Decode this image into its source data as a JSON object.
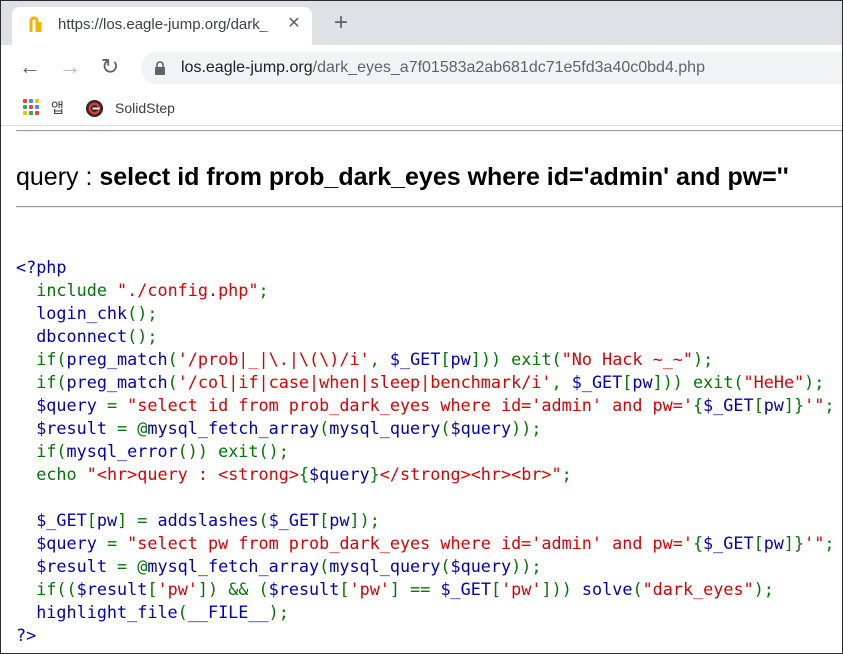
{
  "browser": {
    "tab": {
      "title": "https://los.eagle-jump.org/dark_",
      "close_glyph": "✕",
      "favicon": "tab-favicon-icon"
    },
    "new_tab_glyph": "+",
    "nav": {
      "back": "←",
      "forward": "→",
      "reload": "↻"
    },
    "address": {
      "host": "los.eagle-jump.org",
      "path": "/dark_eyes_a7f01583a2ab681dc71e5fd3a40c0bd4.php",
      "icon": "lock-icon"
    },
    "bookmarks": [
      {
        "label": "앱",
        "icon": "apps-grid-icon"
      },
      {
        "label": "SolidStep",
        "icon": "solidstep-icon"
      }
    ]
  },
  "page": {
    "query_label": "query : ",
    "query_value": "select id from prob_dark_eyes where id='admin' and pw=''",
    "colors": {
      "default": "#0000bb",
      "keyword": "#007700",
      "string": "#dd0000"
    },
    "code_lines": [
      [
        [
          "d",
          "<?php"
        ]
      ],
      [
        [
          "d",
          "  "
        ],
        [
          "k",
          "include "
        ],
        [
          "s",
          "\"./config.php\""
        ],
        [
          "k",
          ";"
        ]
      ],
      [
        [
          "d",
          "  login_chk"
        ],
        [
          "k",
          "();"
        ]
      ],
      [
        [
          "d",
          "  dbconnect"
        ],
        [
          "k",
          "();"
        ]
      ],
      [
        [
          "d",
          "  "
        ],
        [
          "k",
          "if("
        ],
        [
          "d",
          "preg_match"
        ],
        [
          "k",
          "("
        ],
        [
          "s",
          "'/prob|_|\\.|\\(\\)/i'"
        ],
        [
          "k",
          ", "
        ],
        [
          "d",
          "$_GET"
        ],
        [
          "k",
          "["
        ],
        [
          "d",
          "pw"
        ],
        [
          "k",
          "])) exit("
        ],
        [
          "s",
          "\"No Hack ~_~\""
        ],
        [
          "k",
          ");"
        ]
      ],
      [
        [
          "d",
          "  "
        ],
        [
          "k",
          "if("
        ],
        [
          "d",
          "preg_match"
        ],
        [
          "k",
          "("
        ],
        [
          "s",
          "'/col|if|case|when|sleep|benchmark/i'"
        ],
        [
          "k",
          ", "
        ],
        [
          "d",
          "$_GET"
        ],
        [
          "k",
          "["
        ],
        [
          "d",
          "pw"
        ],
        [
          "k",
          "])) exit("
        ],
        [
          "s",
          "\"HeHe\""
        ],
        [
          "k",
          ");"
        ]
      ],
      [
        [
          "d",
          "  $query "
        ],
        [
          "k",
          "= "
        ],
        [
          "s",
          "\"select id from prob_dark_eyes where id='admin' and pw='"
        ],
        [
          "k",
          "{"
        ],
        [
          "d",
          "$_GET"
        ],
        [
          "k",
          "["
        ],
        [
          "d",
          "pw"
        ],
        [
          "k",
          "]}"
        ],
        [
          "s",
          "'\""
        ],
        [
          "k",
          ";"
        ]
      ],
      [
        [
          "d",
          "  $result "
        ],
        [
          "k",
          "= @"
        ],
        [
          "d",
          "mysql_fetch_array"
        ],
        [
          "k",
          "("
        ],
        [
          "d",
          "mysql_query"
        ],
        [
          "k",
          "("
        ],
        [
          "d",
          "$query"
        ],
        [
          "k",
          "));"
        ]
      ],
      [
        [
          "d",
          "  "
        ],
        [
          "k",
          "if("
        ],
        [
          "d",
          "mysql_error"
        ],
        [
          "k",
          "()) exit();"
        ]
      ],
      [
        [
          "d",
          "  "
        ],
        [
          "k",
          "echo "
        ],
        [
          "s",
          "\"<hr>query : <strong>"
        ],
        [
          "k",
          "{"
        ],
        [
          "d",
          "$query"
        ],
        [
          "k",
          "}"
        ],
        [
          "s",
          "</strong><hr><br>\""
        ],
        [
          "k",
          ";"
        ]
      ],
      [
        [
          "d",
          ""
        ]
      ],
      [
        [
          "d",
          "  $_GET"
        ],
        [
          "k",
          "["
        ],
        [
          "d",
          "pw"
        ],
        [
          "k",
          "] = "
        ],
        [
          "d",
          "addslashes"
        ],
        [
          "k",
          "("
        ],
        [
          "d",
          "$_GET"
        ],
        [
          "k",
          "["
        ],
        [
          "d",
          "pw"
        ],
        [
          "k",
          "]);"
        ]
      ],
      [
        [
          "d",
          "  $query "
        ],
        [
          "k",
          "= "
        ],
        [
          "s",
          "\"select pw from prob_dark_eyes where id='admin' and pw='"
        ],
        [
          "k",
          "{"
        ],
        [
          "d",
          "$_GET"
        ],
        [
          "k",
          "["
        ],
        [
          "d",
          "pw"
        ],
        [
          "k",
          "]}"
        ],
        [
          "s",
          "'\""
        ],
        [
          "k",
          ";"
        ]
      ],
      [
        [
          "d",
          "  $result "
        ],
        [
          "k",
          "= @"
        ],
        [
          "d",
          "mysql_fetch_array"
        ],
        [
          "k",
          "("
        ],
        [
          "d",
          "mysql_query"
        ],
        [
          "k",
          "("
        ],
        [
          "d",
          "$query"
        ],
        [
          "k",
          "));"
        ]
      ],
      [
        [
          "d",
          "  "
        ],
        [
          "k",
          "if(("
        ],
        [
          "d",
          "$result"
        ],
        [
          "k",
          "["
        ],
        [
          "s",
          "'pw'"
        ],
        [
          "k",
          "]) && ("
        ],
        [
          "d",
          "$result"
        ],
        [
          "k",
          "["
        ],
        [
          "s",
          "'pw'"
        ],
        [
          "k",
          "] == "
        ],
        [
          "d",
          "$_GET"
        ],
        [
          "k",
          "["
        ],
        [
          "s",
          "'pw'"
        ],
        [
          "k",
          "])) "
        ],
        [
          "d",
          "solve"
        ],
        [
          "k",
          "("
        ],
        [
          "s",
          "\"dark_eyes\""
        ],
        [
          "k",
          ");"
        ]
      ],
      [
        [
          "d",
          "  highlight_file"
        ],
        [
          "k",
          "("
        ],
        [
          "d",
          "__FILE__"
        ],
        [
          "k",
          ");"
        ]
      ],
      [
        [
          "d",
          "?>"
        ]
      ]
    ]
  }
}
